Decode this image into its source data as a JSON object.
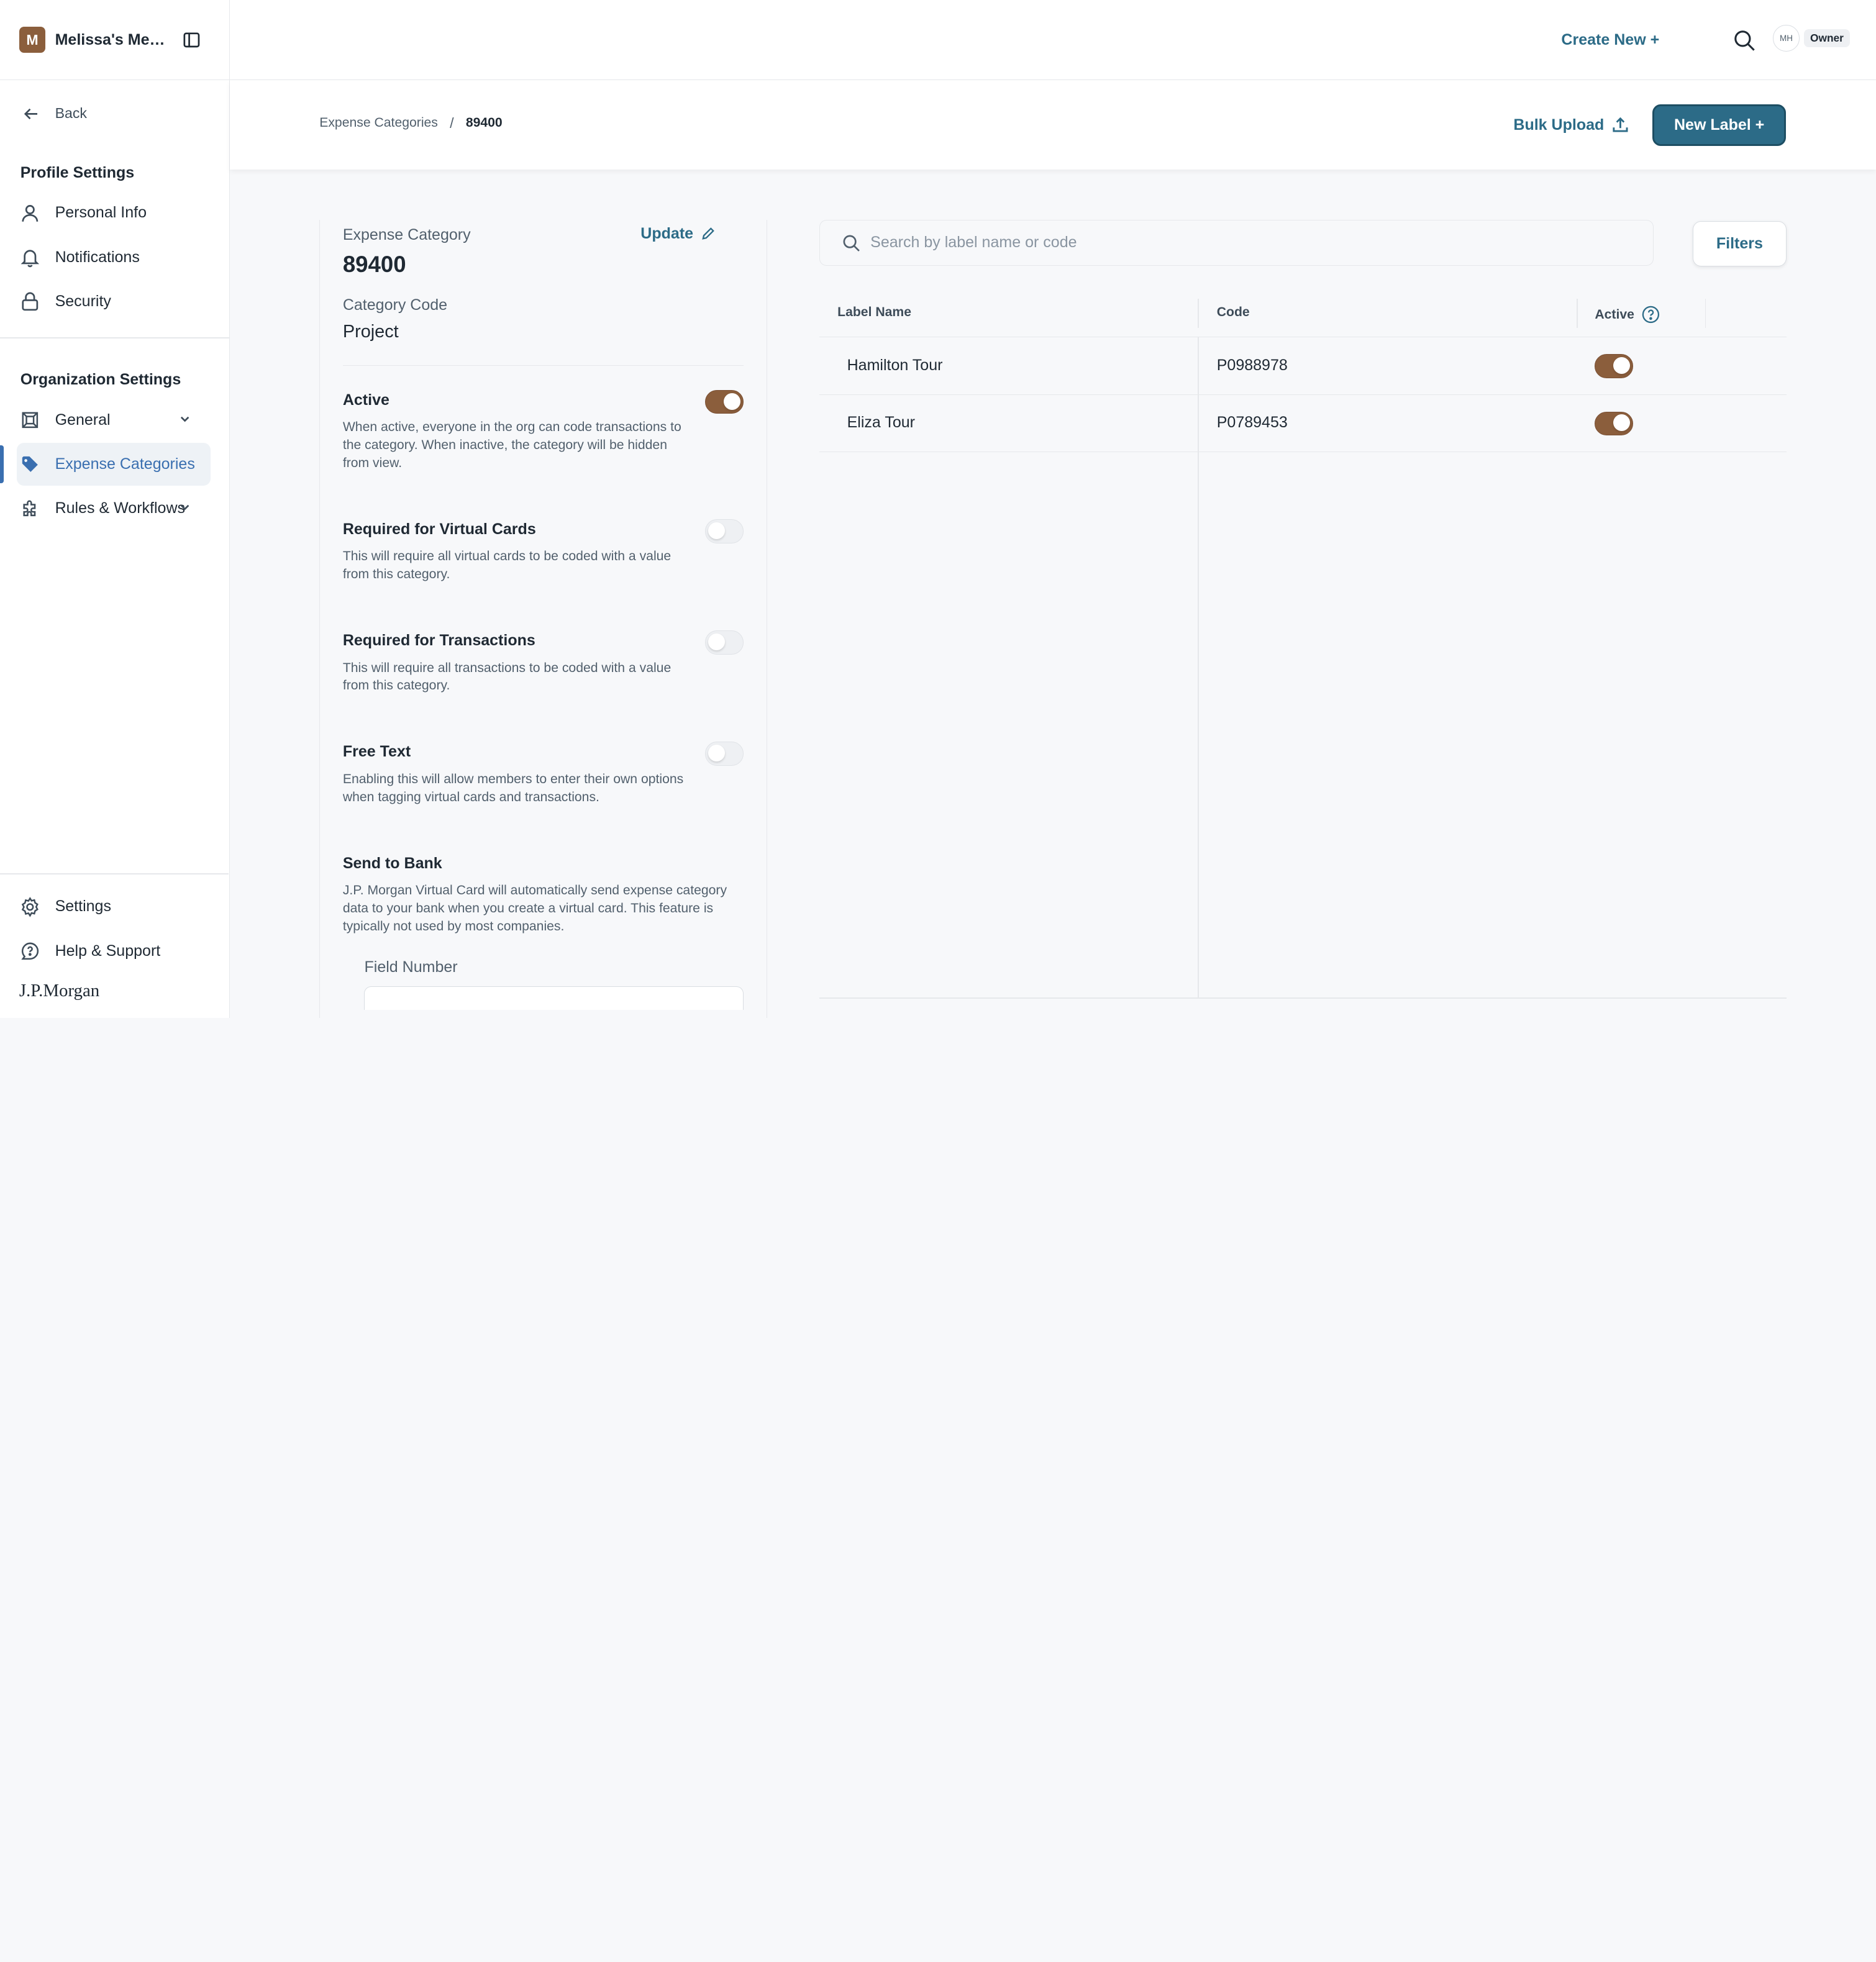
{
  "sidebar": {
    "org_initial": "M",
    "org_name": "Melissa's Mea...",
    "back_label": "Back",
    "profile_title": "Profile Settings",
    "profile_items": [
      {
        "label": "Personal Info",
        "icon": "user-icon"
      },
      {
        "label": "Notifications",
        "icon": "bell-icon"
      },
      {
        "label": "Security",
        "icon": "lock-icon"
      }
    ],
    "org_title": "Organization Settings",
    "org_items": [
      {
        "label": "General",
        "icon": "building-icon",
        "expandable": true
      },
      {
        "label": "Expense Categories",
        "icon": "tag-icon",
        "active": true
      },
      {
        "label": "Rules & Workflows",
        "icon": "puzzle-icon",
        "expandable": true
      }
    ],
    "footer_items": [
      {
        "label": "Settings",
        "icon": "gear-icon"
      },
      {
        "label": "Help & Support",
        "icon": "chat-help-icon"
      }
    ],
    "brand": "J.P.Morgan"
  },
  "header": {
    "create_new": "Create New +",
    "user_initials": "MH",
    "role_badge": "Owner"
  },
  "subheader": {
    "breadcrumb_parent": "Expense Categories",
    "breadcrumb_separator": "/",
    "breadcrumb_current": "89400",
    "bulk_upload": "Bulk Upload",
    "new_label": "New Label +"
  },
  "detail": {
    "category_label": "Expense Category",
    "category_value": "89400",
    "update_label": "Update",
    "code_label": "Category Code",
    "code_value": "Project",
    "settings": [
      {
        "title": "Active",
        "desc": "When active, everyone in the org can code transactions to the category. When inactive, the category will be hidden from view.",
        "on": true
      },
      {
        "title": "Required for Virtual Cards",
        "desc": "This will require all virtual cards to be coded with a value from this category.",
        "on": false
      },
      {
        "title": "Required for Transactions",
        "desc": "This will require all transactions to be coded with a value from this category.",
        "on": false
      },
      {
        "title": "Free Text",
        "desc": "Enabling this will allow members to enter their own options when tagging virtual cards and transactions.",
        "on": false
      },
      {
        "title": "Send to Bank",
        "desc": "J.P. Morgan Virtual Card will automatically send expense category data to your bank when you create a virtual card. This feature is typically not used by most companies.",
        "on": null
      }
    ],
    "field_number_label": "Field Number",
    "field_number_value": ""
  },
  "labels": {
    "search_placeholder": "Search by label name or code",
    "filters_label": "Filters",
    "columns": [
      "Label Name",
      "Code",
      "Active"
    ],
    "rows": [
      {
        "name": "Hamilton Tour",
        "code": "P0988978",
        "active": true
      },
      {
        "name": "Eliza Tour",
        "code": "P0789453",
        "active": true
      }
    ]
  },
  "colors": {
    "accent": "#2c6b87",
    "toggle_on": "#8b5e3c",
    "active_nav": "#3a6fb0"
  }
}
